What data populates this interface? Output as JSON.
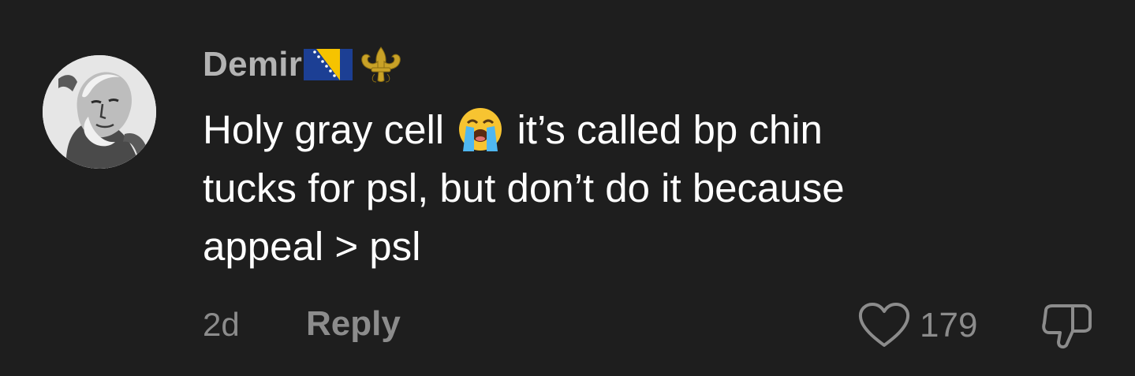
{
  "comment": {
    "username": "Demir",
    "username_badges": [
      "bosnia-flag-icon",
      "fleur-de-lis-icon"
    ],
    "text_lines": [
      {
        "before_emoji": "Holy gray cell",
        "emoji": "loudly-crying-face-icon",
        "after_emoji": "it’s called bp chin"
      },
      "tucks for psl, but don’t do it because",
      "appeal > psl"
    ],
    "timestamp": "2d",
    "reply_label": "Reply",
    "like_count": "179",
    "icons": {
      "like": "heart-icon",
      "dislike": "thumbs-down-icon",
      "avatar": "avatar-image"
    }
  },
  "colors": {
    "background": "#1e1e1e",
    "primary_text": "#ffffff",
    "username": "#b3b3b3",
    "secondary_text": "#8c8c8c"
  }
}
